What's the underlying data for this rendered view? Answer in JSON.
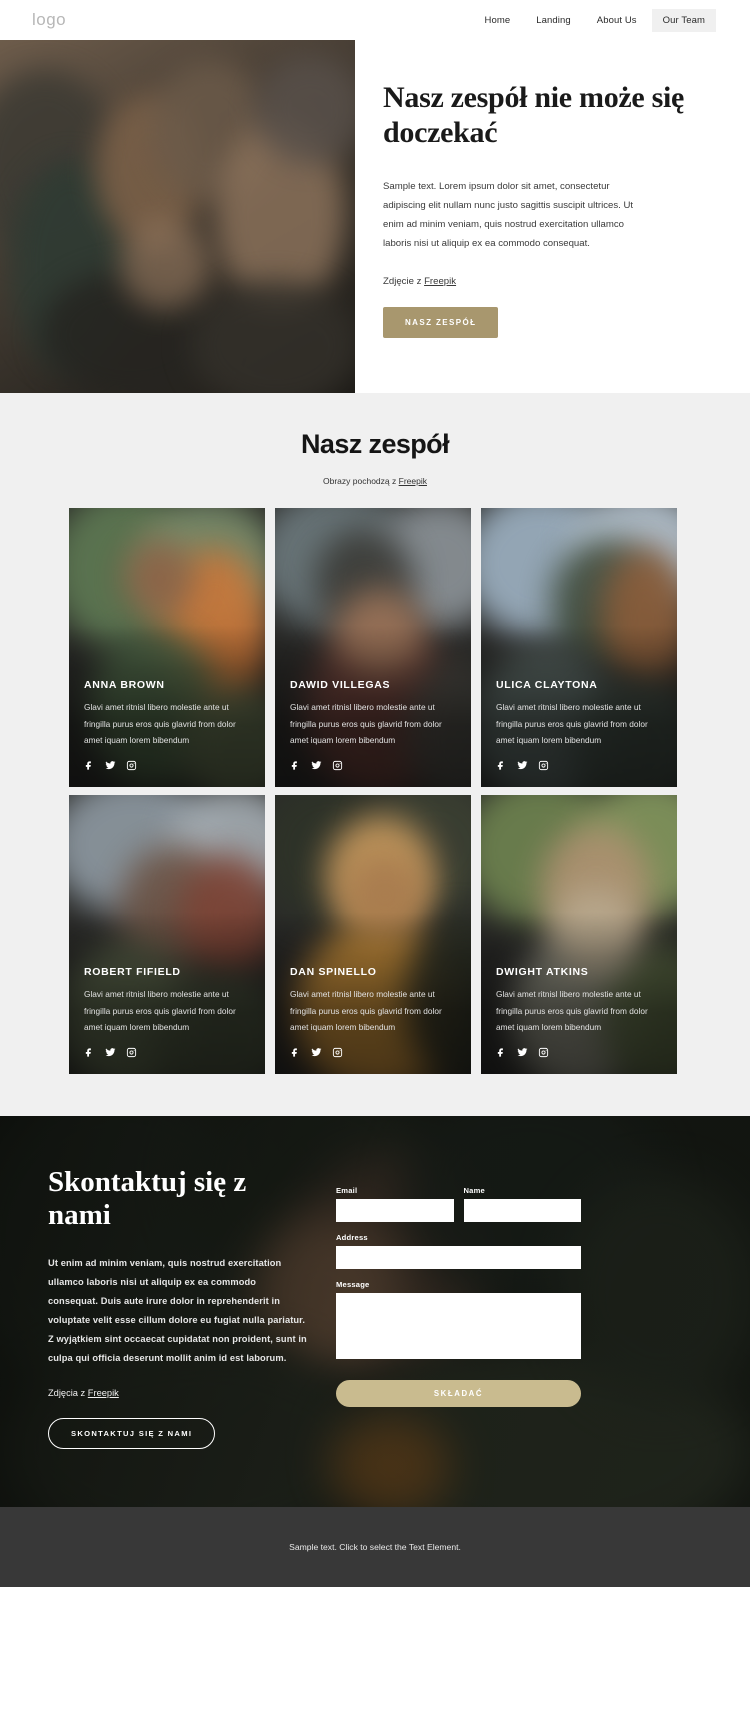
{
  "header": {
    "logo": "logo",
    "nav": [
      {
        "label": "Home",
        "active": false
      },
      {
        "label": "Landing",
        "active": false
      },
      {
        "label": "About Us",
        "active": false
      },
      {
        "label": "Our Team",
        "active": true
      }
    ]
  },
  "hero": {
    "title": "Nasz zespół nie może się doczekać",
    "body": "Sample text. Lorem ipsum dolor sit amet, consectetur adipiscing elit nullam nunc justo sagittis suscipit ultrices. Ut enim ad minim veniam, quis nostrud exercitation ullamco laboris nisi ut aliquip ex ea commodo consequat.",
    "credit_prefix": "Zdjęcie z ",
    "credit_link": "Freepik",
    "button": "NASZ ZESPÓŁ"
  },
  "team": {
    "title": "Nasz zespół",
    "sub_prefix": "Obrazy pochodzą z ",
    "sub_link": "Freepik",
    "member_desc": "Glavi amet ritnisl libero molestie ante ut fringilla purus eros quis glavrid from dolor amet iquam lorem bibendum",
    "socials": [
      "facebook-icon",
      "twitter-icon",
      "instagram-icon"
    ],
    "members": [
      {
        "name": "ANNA BROWN"
      },
      {
        "name": "DAWID VILLEGAS"
      },
      {
        "name": "ULICA CLAYTONA"
      },
      {
        "name": "ROBERT FIFIELD"
      },
      {
        "name": "DAN SPINELLO"
      },
      {
        "name": "DWIGHT ATKINS"
      }
    ]
  },
  "contact": {
    "title": "Skontaktuj się z nami",
    "body": "Ut enim ad minim veniam, quis nostrud exercitation ullamco laboris nisi ut aliquip ex ea commodo consequat. Duis aute irure dolor in reprehenderit in voluptate velit esse cillum dolore eu fugiat nulla pariatur. Z wyjątkiem sint occaecat cupidatat non proident, sunt in culpa qui officia deserunt mollit anim id est laborum.",
    "credit_prefix": "Zdjęcia z ",
    "credit_link": "Freepik",
    "button": "SKONTAKTUJ SIĘ Z NAMI",
    "form": {
      "email_label": "Email",
      "email_value": "",
      "email_placeholder": "",
      "name_label": "Name",
      "name_value": "",
      "name_placeholder": "",
      "address_label": "Address",
      "address_value": "",
      "address_placeholder": "",
      "message_label": "Message",
      "message_value": "",
      "message_placeholder": "",
      "submit": "SKŁADAĆ"
    }
  },
  "footer": {
    "text": "Sample text. Click to select the Text Element."
  },
  "colors": {
    "accent_solid": "#a8976e",
    "accent_submit": "#c9bb8f",
    "team_bg": "#f0f0f0",
    "footer_bg": "#383838",
    "nav_active_bg": "#f0f0f0"
  }
}
